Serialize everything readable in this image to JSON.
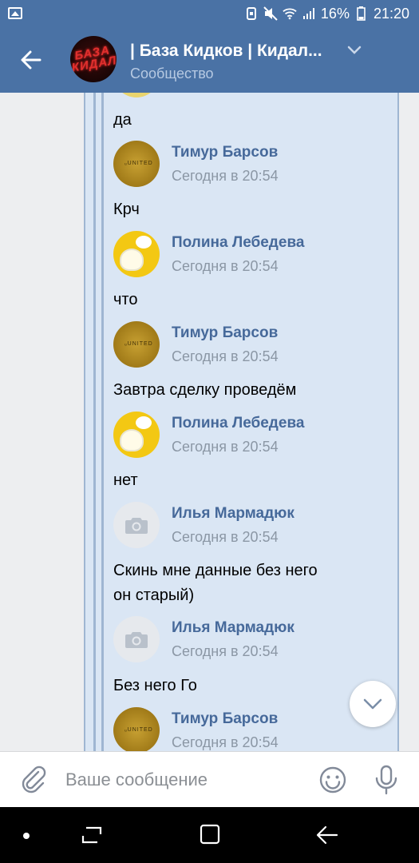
{
  "status_bar": {
    "battery": "16%",
    "time": "21:20"
  },
  "header": {
    "title": "| База Кидков | Кидал...",
    "subtitle": "Сообщество",
    "avatar_text": [
      "БАЗА",
      "КИДАЛ"
    ]
  },
  "messages": [
    {
      "type": "text",
      "text": "да"
    },
    {
      "type": "author",
      "name": "Тимур Барсов",
      "time": "Сегодня в 20:54",
      "avatar": "gold"
    },
    {
      "type": "text",
      "text": "Крч"
    },
    {
      "type": "author",
      "name": "Полина Лебедева",
      "time": "Сегодня в 20:54",
      "avatar": "yellow"
    },
    {
      "type": "text",
      "text": "что"
    },
    {
      "type": "author",
      "name": "Тимур Барсов",
      "time": "Сегодня в 20:54",
      "avatar": "gold"
    },
    {
      "type": "text",
      "text": "Завтра сделку проведём"
    },
    {
      "type": "author",
      "name": "Полина Лебедева",
      "time": "Сегодня в 20:54",
      "avatar": "yellow"
    },
    {
      "type": "text",
      "text": "нет"
    },
    {
      "type": "author",
      "name": "Илья Мармадюк",
      "time": "Сегодня в 20:54",
      "avatar": "camera"
    },
    {
      "type": "text",
      "text": "Скинь мне данные без него"
    },
    {
      "type": "text",
      "text": "он старый)"
    },
    {
      "type": "author",
      "name": "Илья Мармадюк",
      "time": "Сегодня в 20:54",
      "avatar": "camera"
    },
    {
      "type": "text",
      "text": "Без него Го"
    },
    {
      "type": "author",
      "name": "Тимур Барсов",
      "time": "Сегодня в 20:54",
      "avatar": "gold"
    }
  ],
  "composer": {
    "placeholder": "Ваше сообщение"
  },
  "icons": {
    "back": "arrow-left-icon",
    "expand": "chevron-down-icon",
    "attach": "paperclip-icon",
    "emoji": "smile-icon",
    "mic": "microphone-icon",
    "scroll_down": "chevron-down-icon"
  },
  "colors": {
    "header_bg": "#4a72a5",
    "forward_bg": "#dae6f4",
    "author_name": "#46699a",
    "time": "#8b97a5"
  }
}
